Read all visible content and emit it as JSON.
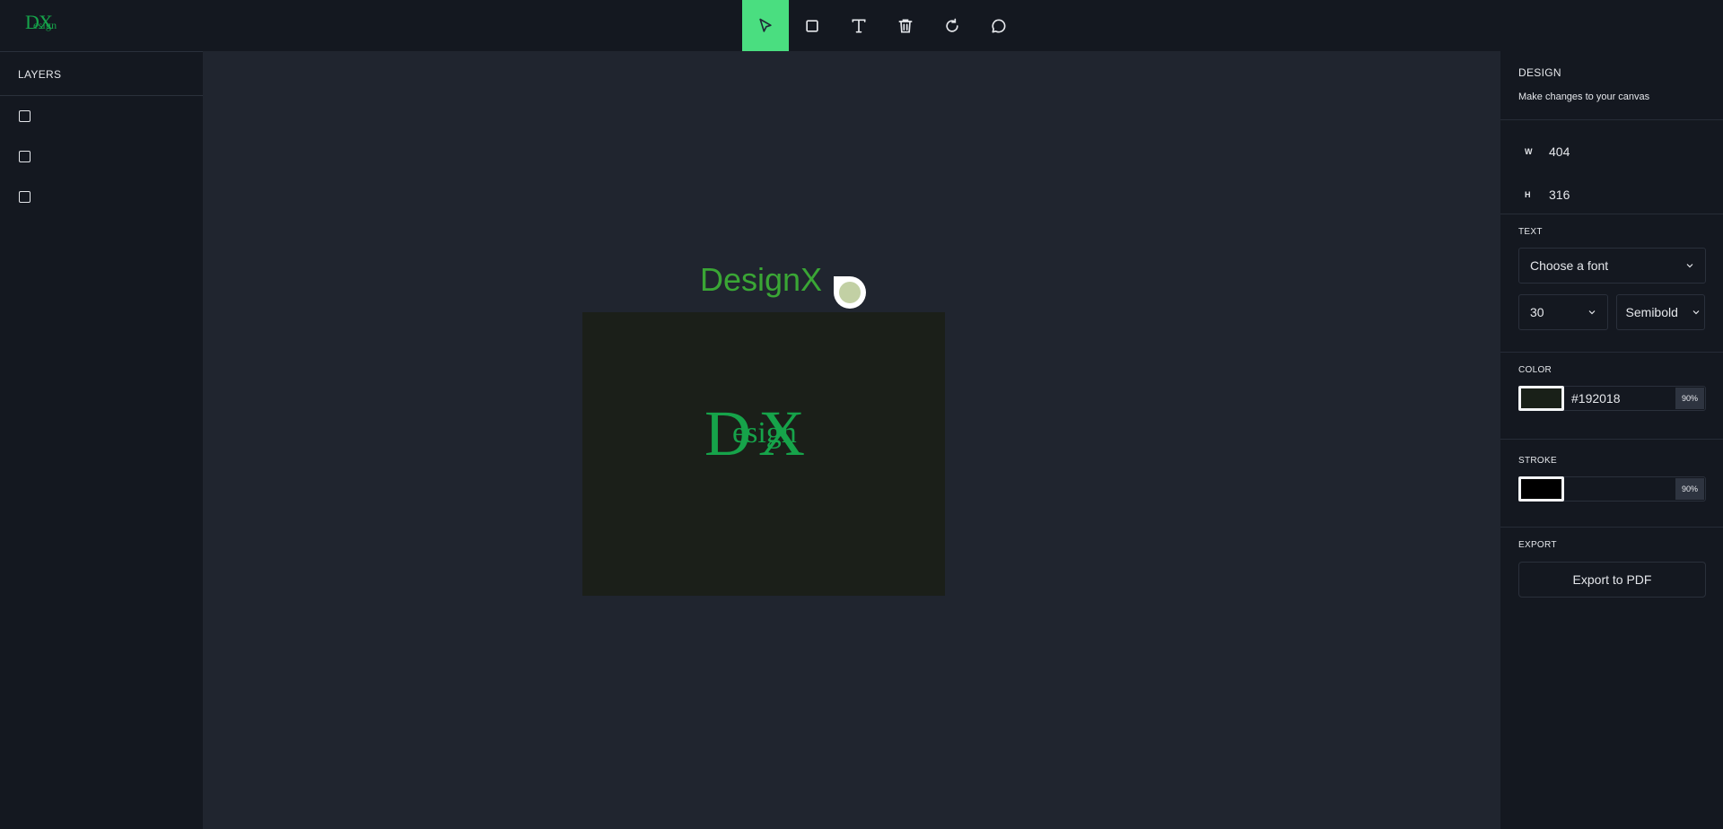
{
  "logo": {
    "big_d": "D",
    "big_x": "X",
    "small": "esign"
  },
  "toolbar": {
    "tools": [
      {
        "name": "select",
        "icon": "pointer-icon",
        "active": true
      },
      {
        "name": "rectangle",
        "icon": "square-icon"
      },
      {
        "name": "text",
        "icon": "text-icon"
      },
      {
        "name": "delete",
        "icon": "trash-icon"
      },
      {
        "name": "reset",
        "icon": "rotate-icon"
      },
      {
        "name": "comment",
        "icon": "chat-bubble-icon"
      }
    ],
    "accent": "#4ade80"
  },
  "layers": {
    "title": "LAYERS",
    "items": [
      {
        "icon": "square-icon"
      },
      {
        "icon": "square-icon"
      },
      {
        "icon": "square-icon"
      }
    ]
  },
  "canvas": {
    "text": "DesignX",
    "text_color": "#3aa635",
    "rect_fill": "#1b1f19",
    "rect_logo": {
      "big_d": "D",
      "big_x": "X",
      "small": "esign"
    }
  },
  "design": {
    "title": "DESIGN",
    "subtitle": "Make changes to your canvas",
    "width_label": "W",
    "width": "404",
    "height_label": "H",
    "height": "316",
    "text_title": "TEXT",
    "font_placeholder": "Choose a font",
    "font_size": "30",
    "font_weight": "Semibold",
    "color_title": "COLOR",
    "color_hex": "#192018",
    "color_swatch": "#192018",
    "color_opacity": "90%",
    "stroke_title": "STROKE",
    "stroke_swatch": "#000000",
    "stroke_opacity": "90%",
    "export_title": "EXPORT",
    "export_label": "Export to PDF"
  }
}
